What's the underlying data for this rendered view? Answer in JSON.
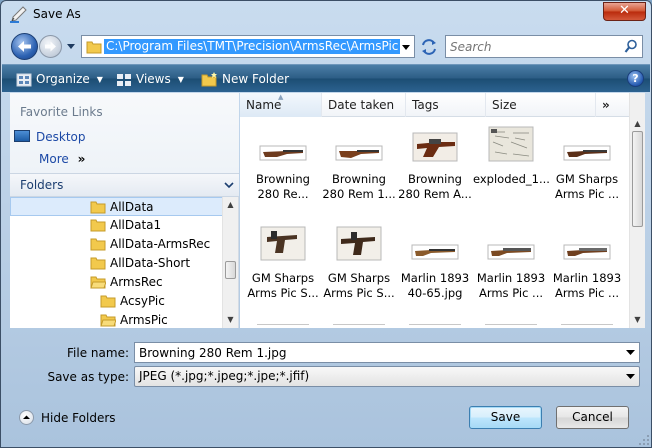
{
  "window": {
    "title": "Save As"
  },
  "address": {
    "path": "C:\\Program Files\\TMT\\Precision\\ArmsRec\\ArmsPic"
  },
  "search": {
    "placeholder": "Search"
  },
  "toolbar": {
    "organize": "Organize",
    "views": "Views",
    "new_folder": "New Folder"
  },
  "favorites": {
    "title": "Favorite Links",
    "items": [
      {
        "label": "Desktop"
      }
    ],
    "more": "More"
  },
  "folders": {
    "title": "Folders",
    "tree": [
      {
        "label": "AllData",
        "selected": true
      },
      {
        "label": "AllData1"
      },
      {
        "label": "AllData-ArmsRec"
      },
      {
        "label": "AllData-Short"
      },
      {
        "label": "ArmsRec"
      },
      {
        "label": "AcsyPic"
      },
      {
        "label": "ArmsPic"
      }
    ]
  },
  "columns": [
    "Name",
    "Date taken",
    "Tags",
    "Size"
  ],
  "files": [
    {
      "name": "Browning 280 Re...",
      "kind": "rifle-long"
    },
    {
      "name": "Browning 280 Rem 1...",
      "kind": "rifle-long"
    },
    {
      "name": "Browning 280 Rem A...",
      "kind": "rifle-action"
    },
    {
      "name": "exploded_1...",
      "kind": "diagram"
    },
    {
      "name": "GM Sharps Arms Pic ...",
      "kind": "rifle-long"
    },
    {
      "name": "GM Sharps Arms Pic S...",
      "kind": "sharps-action"
    },
    {
      "name": "GM Sharps Arms Pic S...",
      "kind": "sharps-action"
    },
    {
      "name": "Marlin 1893 40-65.jpg",
      "kind": "rifle-long"
    },
    {
      "name": "Marlin 1893 Arms Pic ...",
      "kind": "rifle-long"
    },
    {
      "name": "Marlin 1893 Arms Pic ...",
      "kind": "rifle-long"
    }
  ],
  "form": {
    "file_name_label": "File name:",
    "file_name_value": "Browning 280 Rem 1.jpg",
    "save_type_label": "Save as type:",
    "save_type_value": "JPEG (*.jpg;*.jpeg;*.jpe;*.jfif)"
  },
  "footer": {
    "hide_folders": "Hide Folders",
    "save": "Save",
    "cancel": "Cancel"
  },
  "icons": {
    "app": "save-as-quill-icon",
    "back": "back-arrow-icon",
    "forward": "forward-arrow-icon",
    "refresh": "refresh-icon",
    "search": "search-icon",
    "help": "help-icon"
  },
  "colors": {
    "selection": "#3399ff",
    "toolbar": "#2b5c84",
    "link": "#1c49a6"
  }
}
